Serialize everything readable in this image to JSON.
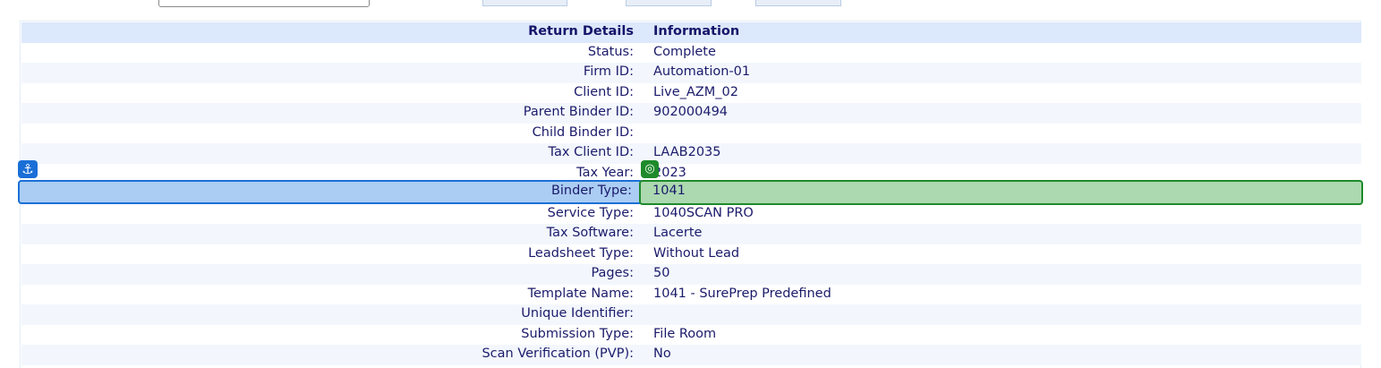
{
  "header": {
    "label_col": "Return Details",
    "value_col": "Information"
  },
  "rows": [
    {
      "label": "Status:",
      "value": "Complete"
    },
    {
      "label": "Firm ID:",
      "value": "Automation-01"
    },
    {
      "label": "Client ID:",
      "value": "Live_AZM_02"
    },
    {
      "label": "Parent Binder ID:",
      "value": "902000494"
    },
    {
      "label": "Child Binder ID:",
      "value": ""
    },
    {
      "label": "Tax Client ID:",
      "value": "LAAB2035"
    },
    {
      "label": "Tax Year:",
      "value": "2023"
    },
    {
      "label": "Binder Type:",
      "value": "1041"
    },
    {
      "label": "Service Type:",
      "value": "1040SCAN PRO"
    },
    {
      "label": "Tax Software:",
      "value": "Lacerte"
    },
    {
      "label": "Leadsheet Type:",
      "value": "Without Lead"
    },
    {
      "label": "Pages:",
      "value": "50"
    },
    {
      "label": "Template Name:",
      "value": "1041 - SurePrep Predefined"
    },
    {
      "label": "Unique Identifier:",
      "value": ""
    },
    {
      "label": "Submission Type:",
      "value": "File Room"
    },
    {
      "label": "Scan Verification (PVP):",
      "value": "No"
    }
  ],
  "badges": {
    "anchor_icon": "anchor-icon",
    "target_icon": "target-icon",
    "anchor_color": "#1a6fd6",
    "target_color": "#1e8a2a"
  }
}
